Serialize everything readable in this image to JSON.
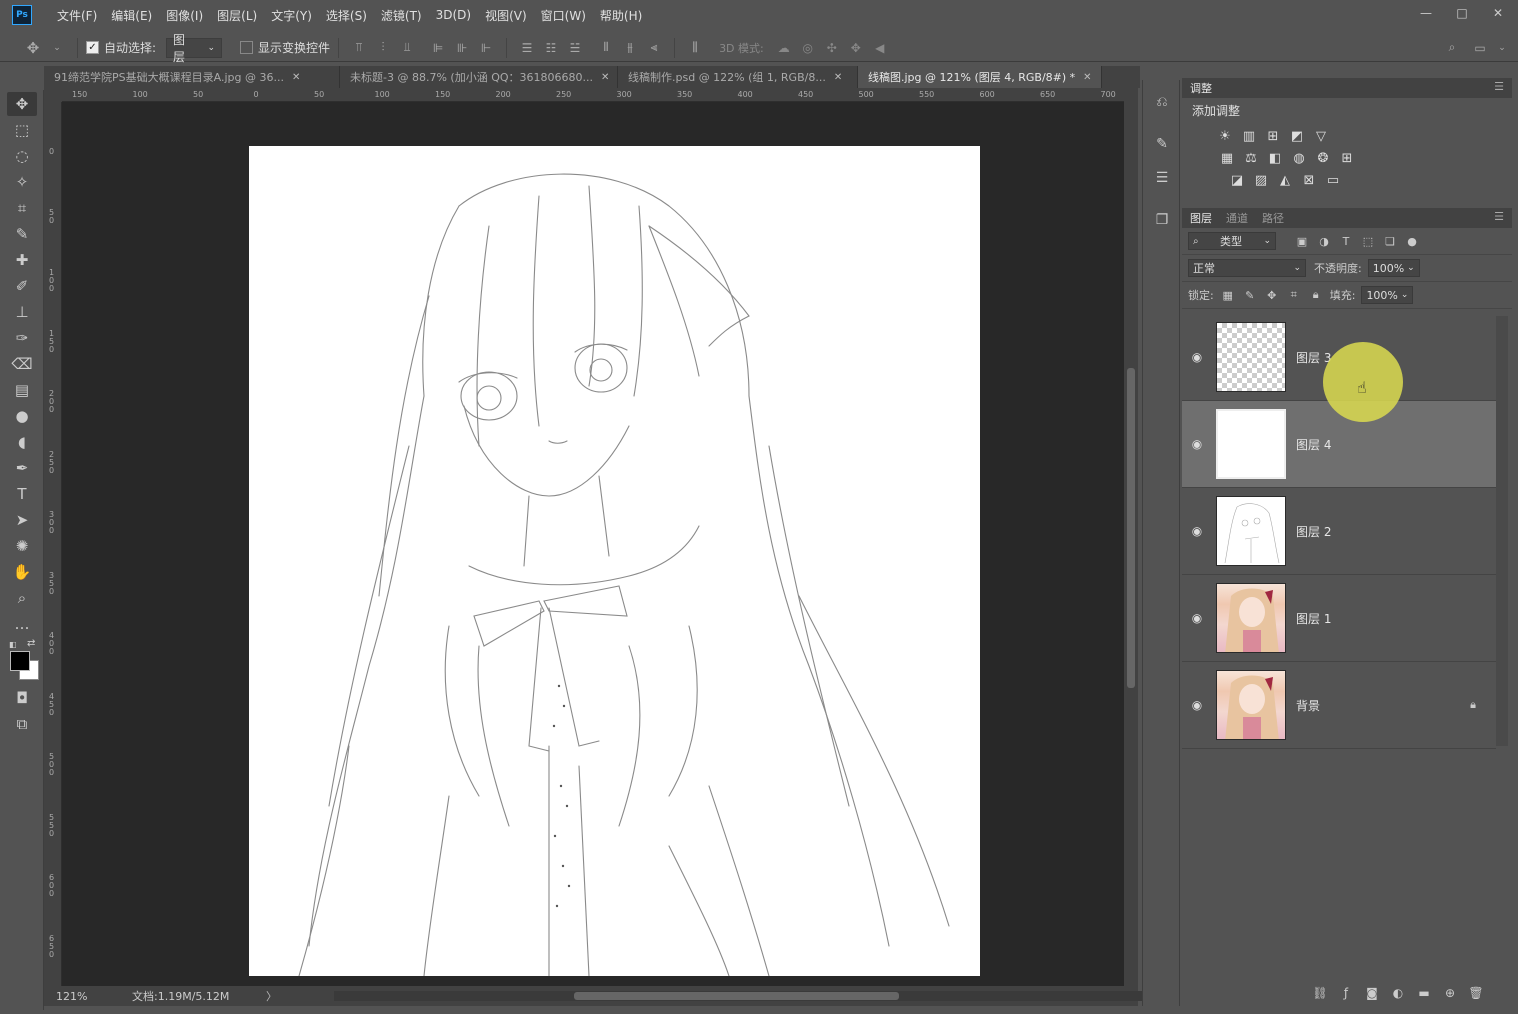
{
  "app": {
    "logo": "Ps"
  },
  "menu": [
    "文件(F)",
    "编辑(E)",
    "图像(I)",
    "图层(L)",
    "文字(Y)",
    "选择(S)",
    "滤镜(T)",
    "3D(D)",
    "视图(V)",
    "窗口(W)",
    "帮助(H)"
  ],
  "window_controls": {
    "minimize": "—",
    "maximize": "□",
    "close": "✕"
  },
  "options": {
    "auto_select_label": "自动选择:",
    "auto_select_checked": true,
    "auto_select_value": "图层",
    "show_transform_label": "显示变换控件",
    "show_transform_checked": false,
    "mode_3d_label": "3D 模式:"
  },
  "tabs": [
    {
      "label": "91缔范学院PS基础大概课程目录A.jpg @ 36...",
      "active": false
    },
    {
      "label": "未标题-3 @ 88.7% (加小涵 QQ：361806680...",
      "active": false
    },
    {
      "label": "线稿制作.psd @ 122% (组 1, RGB/8...",
      "active": false
    },
    {
      "label": "线稿图.jpg @ 121% (图层 4, RGB/8#) *",
      "active": true
    }
  ],
  "ruler_h_ticks": [
    "150",
    "100",
    "50",
    "0",
    "50",
    "100",
    "150",
    "200",
    "250",
    "300",
    "350",
    "400",
    "450",
    "500",
    "550",
    "600",
    "650",
    "700"
  ],
  "ruler_v_ticks": [
    "0",
    "5\n0",
    "1\n0\n0",
    "1\n5\n0",
    "2\n0\n0",
    "2\n5\n0",
    "3\n0\n0",
    "3\n5\n0",
    "4\n0\n0",
    "4\n5\n0",
    "5\n0\n0",
    "5\n5\n0",
    "6\n0\n0",
    "6\n5\n0"
  ],
  "status": {
    "zoom": "121%",
    "doc_info": "文档:1.19M/5.12M",
    "arrow": "〉"
  },
  "adjustments": {
    "panel_tab": "调整",
    "title": "添加调整"
  },
  "layers_panel": {
    "tabs": [
      "图层",
      "通道",
      "路径"
    ],
    "filter_label": "类型",
    "blend_mode": "正常",
    "opacity_label": "不透明度:",
    "opacity_value": "100%",
    "lock_label": "锁定:",
    "fill_label": "填充:",
    "fill_value": "100%",
    "layers": [
      {
        "name": "图层 3",
        "thumb": "checker",
        "selected": false,
        "locked": false
      },
      {
        "name": "图层 4",
        "thumb": "white",
        "selected": true,
        "locked": false
      },
      {
        "name": "图层 2",
        "thumb": "sketch",
        "selected": false,
        "locked": false
      },
      {
        "name": "图层 1",
        "thumb": "color",
        "selected": false,
        "locked": false
      },
      {
        "name": "背景",
        "thumb": "color",
        "selected": false,
        "locked": true
      }
    ]
  },
  "colors": {
    "panel_bg": "#535353",
    "dark_bg": "#424242",
    "canvas_bg": "#282828",
    "accent_ps": "#31a8ff",
    "highlight": "#dcdc50"
  }
}
